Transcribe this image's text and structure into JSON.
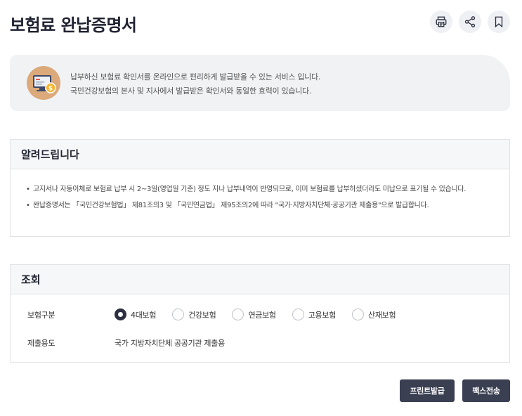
{
  "header": {
    "title": "보험료 완납증명서",
    "actions": [
      {
        "name": "print-icon"
      },
      {
        "name": "share-icon"
      },
      {
        "name": "bookmark-icon"
      }
    ]
  },
  "banner": {
    "icon": "monitor-coin-icon",
    "line1": "납부하신 보험료 확인서를 온라인으로 편리하게 발급받을 수 있는 서비스 입니다.",
    "line2": "국민건강보험의 본사 및 지사에서 발급받은 확인서와 동일한 효력이 있습니다."
  },
  "notice": {
    "title": "알려드립니다",
    "items": [
      "고지서나 자동이체로 보험료 납부 시 2~3일(영업일 기준) 정도 지나 납부내역이 반영되므로, 이미 보험료를 납부하셨더라도 미납으로 표기될 수 있습니다.",
      "완납증명서는 「국민건강보험법」 제81조의3 및 「국민연금법」 제95조의2에 따라 \"국가·지방자치단체·공공기관 제출용\"으로 발급합니다."
    ]
  },
  "query": {
    "title": "조회",
    "insurance_type_label": "보험구분",
    "options": [
      {
        "label": "4대보험",
        "checked": true
      },
      {
        "label": "건강보험",
        "checked": false
      },
      {
        "label": "연금보험",
        "checked": false
      },
      {
        "label": "고용보험",
        "checked": false
      },
      {
        "label": "산재보험",
        "checked": false
      }
    ],
    "purpose_label": "제출용도",
    "purpose_value": "국가 지방자치단체 공공기관 제출용"
  },
  "buttons": {
    "print_issue": "프린트발급",
    "fax_send": "팩스전송"
  },
  "colors": {
    "primary_dark": "#3a3f52",
    "banner_bg": "#f1f2f4",
    "box_head_bg": "#f6f7f8"
  }
}
